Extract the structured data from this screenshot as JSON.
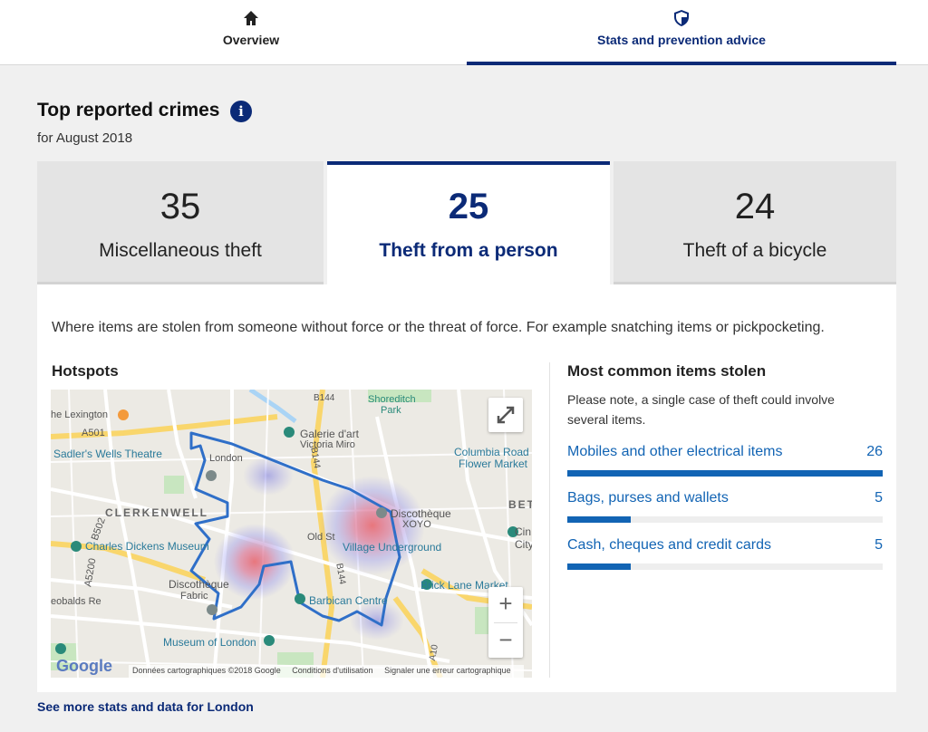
{
  "nav": {
    "tabs": [
      {
        "label": "Overview",
        "icon": "home-icon"
      },
      {
        "label": "Stats and prevention advice",
        "icon": "shield-icon",
        "active": true
      }
    ]
  },
  "section": {
    "title": "Top reported crimes",
    "subtitle": "for August 2018"
  },
  "crimes": [
    {
      "count": "35",
      "name": "Miscellaneous theft"
    },
    {
      "count": "25",
      "name": "Theft from a person",
      "selected": true
    },
    {
      "count": "24",
      "name": "Theft of a bicycle"
    }
  ],
  "panel": {
    "description": "Where items are stolen from someone without force or the threat of force. For example snatching items or pickpocketing.",
    "hotspots_title": "Hotspots"
  },
  "map": {
    "labels": {
      "lexington": "he Lexington",
      "a501": "A501",
      "sadlers": "Sadler's Wells Theatre",
      "clerkenwell": "CLERKENWELL",
      "dickens": "Charles Dickens Museum",
      "b502": "B502",
      "a5200": "A5200",
      "theobalds": "eobalds Re",
      "discotheque1": "Discothèque",
      "fabric": "Fabric",
      "museum": "Museum of London",
      "galerie": "Galerie d'art",
      "victoria": "Victoria Miro",
      "shoreditch": "Shoreditch",
      "park": "Park",
      "columbia": "Columbia Road",
      "flower": "Flower Market",
      "discotheque2": "Discothèque",
      "xoyo": "XOYO",
      "village": "Village Underground",
      "brick": "Brick Lane Market",
      "barbican": "Barbican Centre",
      "oldst": "Old St",
      "b144a": "B144",
      "b144b": "B144",
      "b144c": "B144",
      "a10": "A10",
      "bet": "BET",
      "city": "City",
      "london_uni": "London",
      "cin": "Cin"
    },
    "google": "Google",
    "attribution": {
      "data": "Données cartographiques ©2018 Google",
      "terms": "Conditions d'utilisation",
      "report": "Signaler une erreur cartographique"
    },
    "zoom_in": "+",
    "zoom_out": "−"
  },
  "most_common": {
    "title": "Most common items stolen",
    "note": "Please note, a single case of theft could involve several items.",
    "items": [
      {
        "label": "Mobiles and other electrical items",
        "count": "26",
        "fraction": 1.0
      },
      {
        "label": "Bags, purses and wallets",
        "count": "5",
        "fraction": 0.2
      },
      {
        "label": "Cash, cheques and credit cards",
        "count": "5",
        "fraction": 0.2
      }
    ]
  },
  "footer": {
    "see_more": "See more stats and data for London"
  },
  "colors": {
    "brand": "#0b2a77",
    "link": "#1264b4",
    "hotspot_core": "#e8626a",
    "hotspot_halo": "#8c8cf0"
  }
}
